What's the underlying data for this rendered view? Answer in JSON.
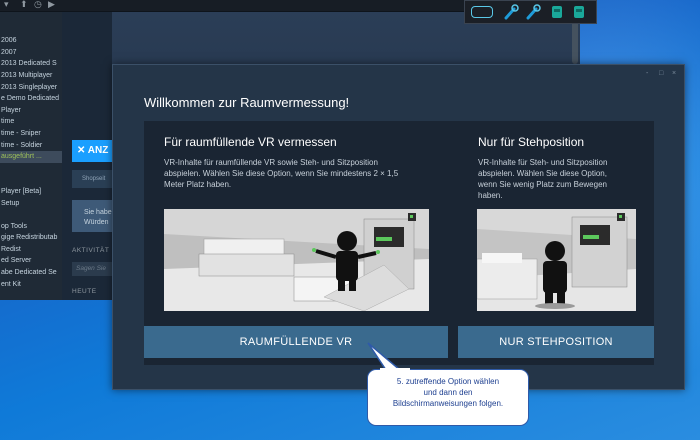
{
  "steam": {
    "topbar_glyphs": [
      "▾",
      "⬆",
      "◷",
      "▶"
    ],
    "sidebar": [
      {
        "label": "",
        "type": "blank"
      },
      {
        "label": "",
        "type": "blank"
      },
      {
        "label": "2006",
        "type": "item"
      },
      {
        "label": "2007",
        "type": "item"
      },
      {
        "label": "2013 Dedicated S",
        "type": "item"
      },
      {
        "label": "2013 Multiplayer",
        "type": "item"
      },
      {
        "label": "2013 Singleplayer",
        "type": "item"
      },
      {
        "label": "e Demo Dedicated",
        "type": "item"
      },
      {
        "label": "Player",
        "type": "item"
      },
      {
        "label": "time",
        "type": "item"
      },
      {
        "label": "time - Sniper",
        "type": "item"
      },
      {
        "label": "time - Soldier",
        "type": "item"
      },
      {
        "label": "ausgeführt ...",
        "type": "highlight"
      },
      {
        "label": "",
        "type": "blank"
      },
      {
        "label": "",
        "type": "blank"
      },
      {
        "label": "Player [Beta]",
        "type": "item"
      },
      {
        "label": "Setup",
        "type": "item"
      },
      {
        "label": "",
        "type": "blank"
      },
      {
        "label": "op Tools",
        "type": "item"
      },
      {
        "label": "gige Redistributab",
        "type": "item"
      },
      {
        "label": "Redist",
        "type": "item"
      },
      {
        "label": "ed Server",
        "type": "item"
      },
      {
        "label": "abe Dedicated Se",
        "type": "item"
      },
      {
        "label": "ent Kit",
        "type": "item"
      }
    ],
    "install_button": "ANZ",
    "shop_label": "Shopseit",
    "hint_lines": [
      "Sie habe",
      "Würden"
    ],
    "activity_label": "AKTIVITÄT",
    "activity_placeholder": "Sagen Sie",
    "today_label": "HEUTE"
  },
  "dialog": {
    "title": "Willkommen zur Raumvermessung!",
    "controls": [
      "-",
      "□",
      "×"
    ],
    "room_scale": {
      "title": "Für raumfüllende VR vermessen",
      "desc": [
        "VR-Inhalte für raumfüllende VR sowie Steh- und Sitzposition",
        "abspielen. Wählen Sie diese Option, wenn Sie mindestens 2 × 1,5",
        "Meter Platz haben."
      ],
      "button": "RAUMFÜLLENDE VR"
    },
    "standing": {
      "title": "Nur für Stehposition",
      "desc": [
        "VR-Inhalte für Steh- und Sitzposition",
        "abspielen. Wählen Sie diese Option,",
        "wenn Sie wenig Platz zum Bewegen",
        "haben."
      ],
      "button": "NUR STEHPOSITION"
    }
  },
  "tooltip": {
    "lines": [
      "5. zutreffende Option wählen",
      "und dann den",
      "Bildschirmanweisungen folgen."
    ]
  },
  "colors": {
    "dialog_bg": "#243548",
    "card_bg": "#1a2533",
    "button_bg": "#3a6a8e",
    "tooltip_text": "#1d3f90",
    "accent_green": "#5cc85c"
  },
  "icons": [
    "hmd-icon",
    "controller-left-icon",
    "controller-right-icon",
    "base-station-icon",
    "base-station-icon"
  ]
}
